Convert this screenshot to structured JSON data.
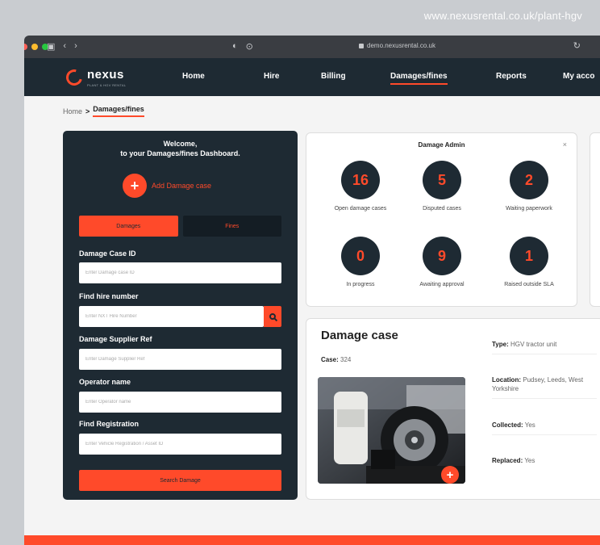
{
  "caption_url": "www.nexusrental.co.uk/plant-hgv",
  "browser": {
    "address": "demo.nexusrental.co.uk",
    "traffic_colors": [
      "#ff5f57",
      "#febc2e",
      "#28c840"
    ]
  },
  "brand": {
    "name": "nexus",
    "tagline": "PLANT & HGV RENTAL",
    "accent": "#ff4a2a",
    "navy": "#1e2a33"
  },
  "nav": {
    "home": "Home",
    "hire": "Hire",
    "billing": "Billing",
    "damages": "Damages/fines",
    "reports": "Reports",
    "account": "My acco"
  },
  "breadcrumb": {
    "home": "Home",
    "separator": ">",
    "current": "Damages/fines"
  },
  "search_panel": {
    "welcome_line1": "Welcome,",
    "welcome_line2": "to your Damages/fines Dashboard.",
    "add_case": "Add Damage case",
    "tab_damages": "Damages",
    "tab_fines": "Fines",
    "fields": {
      "case_id": {
        "label": "Damage Case ID",
        "placeholder": "Enter Damage case ID"
      },
      "hire_number": {
        "label": "Find hire number",
        "placeholder": "Enter NXT Hire Number"
      },
      "supplier_ref": {
        "label": "Damage Supplier Ref",
        "placeholder": "Enter Damage Supplier Ref"
      },
      "operator": {
        "label": "Operator name",
        "placeholder": "Enter Operator name"
      },
      "registration": {
        "label": "Find Registration",
        "placeholder": "Enter Vehicle Registration / Asset ID"
      }
    },
    "submit": "Search Damage"
  },
  "admin": {
    "title": "Damage Admin",
    "close": "×",
    "stats": [
      {
        "value": "16",
        "label": "Open damage cases"
      },
      {
        "value": "5",
        "label": "Disputed cases"
      },
      {
        "value": "2",
        "label": "Waiting paperwork"
      },
      {
        "value": "0",
        "label": "In progress"
      },
      {
        "value": "9",
        "label": "Awaiting approval"
      },
      {
        "value": "1",
        "label": "Raised outside SLA"
      }
    ]
  },
  "case": {
    "title": "Damage case",
    "case_label": "Case:",
    "case_value": "324",
    "plus": "+",
    "details": {
      "type_label": "Type:",
      "type_value": "HGV tractor unit",
      "location_label": "Location:",
      "location_value": "Pudsey, Leeds, West Yorkshire",
      "collected_label": "Collected:",
      "collected_value": "Yes",
      "replaced_label": "Replaced:",
      "replaced_value": "Yes"
    }
  }
}
